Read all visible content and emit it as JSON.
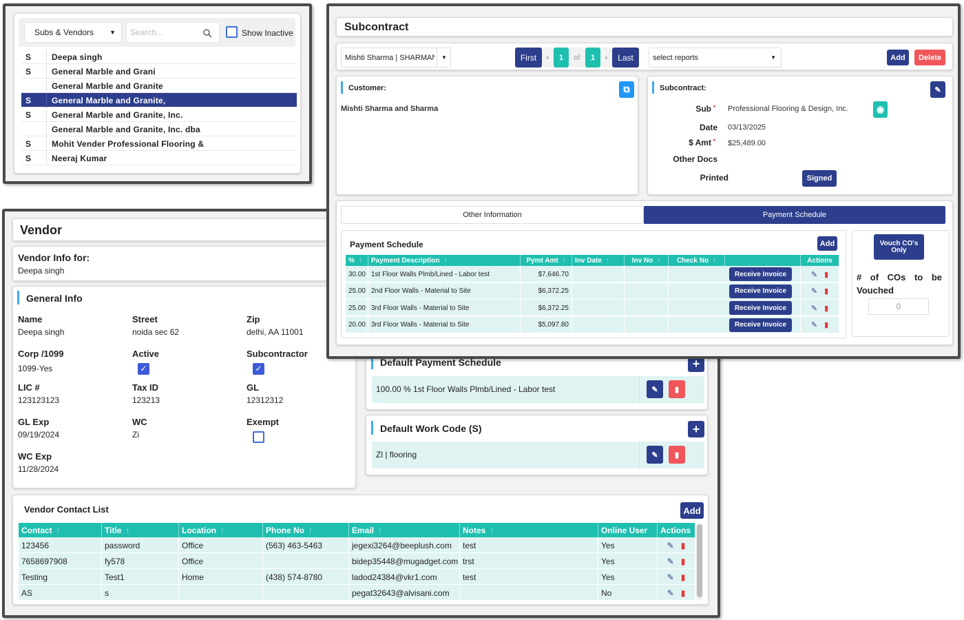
{
  "vendor_list": {
    "filter": "Subs & Vendors",
    "search_placeholder": "Search...",
    "show_inactive": "Show Inactive",
    "items": [
      {
        "tag": "S",
        "name": "Deepa singh"
      },
      {
        "tag": "S",
        "name": "General Marble and Grani"
      },
      {
        "tag": "",
        "name": "General Marble and Granite"
      },
      {
        "tag": "S",
        "name": "General Marble and Granite,"
      },
      {
        "tag": "S",
        "name": "General Marble and Granite, Inc."
      },
      {
        "tag": "",
        "name": "General Marble and Granite, Inc. dba"
      },
      {
        "tag": "S",
        "name": "Mohit Vender Professional Flooring &"
      },
      {
        "tag": "S",
        "name": "Neeraj Kumar"
      }
    ]
  },
  "vendor": {
    "title": "Vendor",
    "info_for_label": "Vendor Info for:",
    "info_for_value": "Deepa singh",
    "general_info": "General Info",
    "fields": {
      "name_label": "Name",
      "name_value": "Deepa singh",
      "street_label": "Street",
      "street_value": "noida sec 62",
      "zip_label": "Zip",
      "zip_value": "delhi, AA 11001",
      "corp_label": "Corp /1099",
      "corp_value": "1099-Yes",
      "active_label": "Active",
      "subcontractor_label": "Subcontractor",
      "lic_label": "LIC #",
      "lic_value": "123123123",
      "taxid_label": "Tax ID",
      "taxid_value": "123213",
      "gl_label": "GL",
      "gl_value": "12312312",
      "glexp_label": "GL Exp",
      "glexp_value": "09/19/2024",
      "wc_label": "WC",
      "wc_value": "Zi",
      "exempt_label": "Exempt",
      "wcexp_label": "WC Exp",
      "wcexp_value": "11/28/2024"
    },
    "default_payment": {
      "title": "Default Payment Schedule",
      "item": "100.00 % 1st Floor Walls Plmb/Lined - Labor test"
    },
    "default_work_code": {
      "title": "Default Work Code (S)",
      "item": "Zl | flooring"
    },
    "contacts": {
      "title": "Vendor Contact List",
      "add": "Add",
      "headers": [
        "Contact",
        "Title",
        "Location",
        "Phone No",
        "Email",
        "Notes",
        "Online User",
        "Actions"
      ],
      "rows": [
        [
          "123456",
          "password",
          "Office",
          "(563) 463-5463",
          "jegexi3264@beeplush.com",
          "test",
          "Yes"
        ],
        [
          "7658697908",
          "fy578",
          "Office",
          "",
          "bidep35448@mugadget.com",
          "trst",
          "Yes"
        ],
        [
          "Testing",
          "Test1",
          "Home",
          "(438) 574-8780",
          "ladod24384@vkr1.com",
          "test",
          "Yes"
        ],
        [
          "AS",
          "s",
          "",
          "",
          "pegat32643@alvisani.com",
          "",
          "No"
        ]
      ]
    }
  },
  "subcontract": {
    "title": "Subcontract",
    "customer_select": "Mishti Sharma | SHARMAN",
    "nav": {
      "first": "First",
      "prev": "‹",
      "page": "1",
      "of": "of",
      "total": "1",
      "next": "›",
      "last": "Last"
    },
    "reports_placeholder": "select reports",
    "add": "Add",
    "delete": "Delete",
    "customer_label": "Customer:",
    "customer_value": "Mishti Sharma and Sharma",
    "subcontract_label": "Subcontract:",
    "sub_label": "Sub",
    "sub_value": "Professional Flooring & Design, Inc.",
    "date_label": "Date",
    "date_value": "03/13/2025",
    "amt_label": "$ Amt",
    "amt_value": "$25,489.00",
    "other_docs_label": "Other Docs",
    "printed_label": "Printed",
    "signed": "Signed",
    "tabs": [
      "Other Information",
      "Payment Schedule"
    ],
    "payment_schedule": {
      "title": "Payment Schedule",
      "add": "Add",
      "headers": [
        "%",
        "Payment Description",
        "Pymt Amt",
        "Inv Date",
        "Inv No",
        "Check No",
        "",
        "Actions"
      ],
      "receive_label": "Receive Invoice",
      "rows": [
        [
          "30.00",
          "1st Floor Walls Plmb/Lined - Labor test",
          "$7,646.70"
        ],
        [
          "25.00",
          "2nd Floor Walls - Material to Site",
          "$6,372.25"
        ],
        [
          "25.00",
          "3rd Floor Walls - Material to Site",
          "$6,372.25"
        ],
        [
          "20.00",
          "3rd Floor Walls - Material to Site",
          "$5,097.80"
        ]
      ]
    },
    "vouch": {
      "button": "Vouch CO's Only",
      "label": "# of COs to be Vouched",
      "value": "0"
    }
  },
  "colors": {
    "navy": "#2c3e8c",
    "teal": "#1fbfb0",
    "danger": "#f0565a",
    "row_bg": "#dff4f2"
  }
}
